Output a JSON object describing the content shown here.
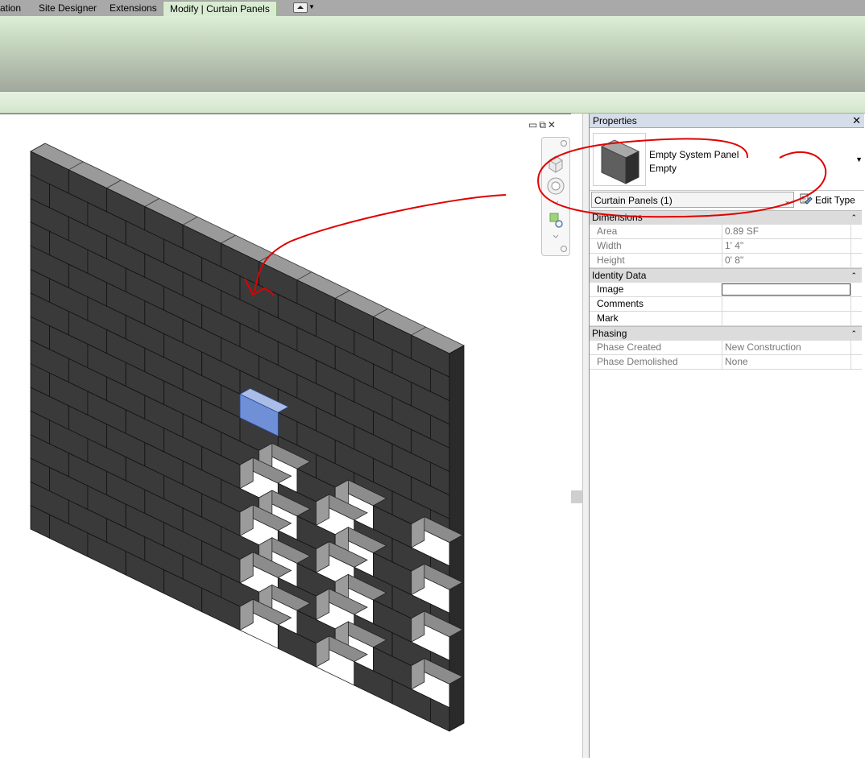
{
  "ribbon": {
    "tabs": [
      {
        "label": "ation"
      },
      {
        "label": "Site Designer"
      },
      {
        "label": "Extensions"
      },
      {
        "label": "Modify | Curtain Panels"
      }
    ],
    "active_tab": "Modify | Curtain Panels",
    "extra_button_icon": "ribbon-minimize-icon"
  },
  "view": {
    "controls": [
      "minimize-icon",
      "restore-icon",
      "close-icon"
    ],
    "navbar_icons": [
      "close-icon",
      "viewcube-icon",
      "steering-wheel-icon",
      "zoom-icon"
    ]
  },
  "properties": {
    "title": "Properties",
    "type_name": "Empty System Panel",
    "type_sub": "Empty",
    "filter_label": "Curtain Panels (1)",
    "edit_type_label": "Edit Type",
    "groups": [
      {
        "name": "Dimensions",
        "rows": [
          {
            "label": "Area",
            "value": "0.89 SF"
          },
          {
            "label": "Width",
            "value": "1'  4\""
          },
          {
            "label": "Height",
            "value": "0'  8\""
          }
        ]
      },
      {
        "name": "Identity Data",
        "rows": [
          {
            "label": "Image",
            "value": ""
          },
          {
            "label": "Comments",
            "value": ""
          },
          {
            "label": "Mark",
            "value": ""
          }
        ]
      },
      {
        "name": "Phasing",
        "rows": [
          {
            "label": "Phase Created",
            "value": "New Construction"
          },
          {
            "label": "Phase Demolished",
            "value": "None"
          }
        ]
      }
    ]
  },
  "colors": {
    "ribbon_green": "#d9ecd3",
    "brick_face": "#3a3a3a",
    "brick_top": "#9a9a9a",
    "selection_blue": "#6f8fd6",
    "annotation_red": "#e00000"
  }
}
